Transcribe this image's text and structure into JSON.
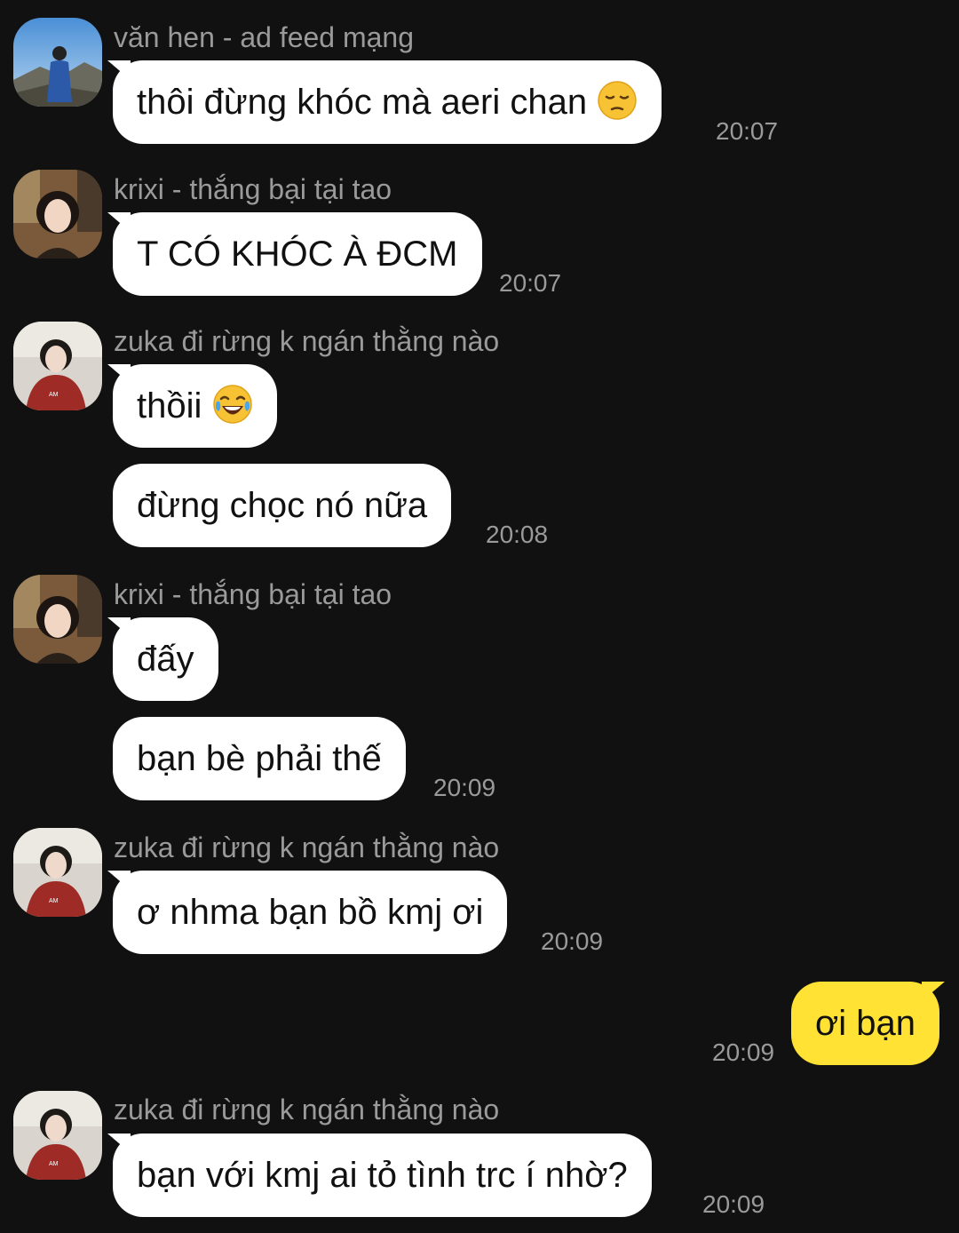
{
  "senders": {
    "van_hen": "văn hen - ad feed mạng",
    "krixi": "krixi - thắng bại tại tao",
    "zuka": "zuka đi rừng k ngán thằng nào"
  },
  "messages": [
    {
      "text": "thôi đừng khóc mà aeri chan",
      "emoji": "pensive-face-icon",
      "time": "20:07"
    },
    {
      "text": "T CÓ KHÓC À ĐCM",
      "time": "20:07"
    },
    {
      "text": "thồii",
      "emoji": "laughing-tears-face-icon"
    },
    {
      "text": "đừng chọc nó nữa",
      "time": "20:08"
    },
    {
      "text": "đấy"
    },
    {
      "text": "bạn bè phải thế",
      "time": "20:09"
    },
    {
      "text": "ơ nhma bạn bồ kmj ơi",
      "time": "20:09"
    },
    {
      "text": "ơi bạn",
      "time": "20:09",
      "mine": true
    },
    {
      "text": "bạn với kmj ai tỏ tình trc í nhờ?",
      "time": "20:09"
    }
  ],
  "colors": {
    "background": "#111111",
    "incoming_bubble": "#ffffff",
    "outgoing_bubble": "#ffe233",
    "meta_text": "#9a9a9a"
  }
}
